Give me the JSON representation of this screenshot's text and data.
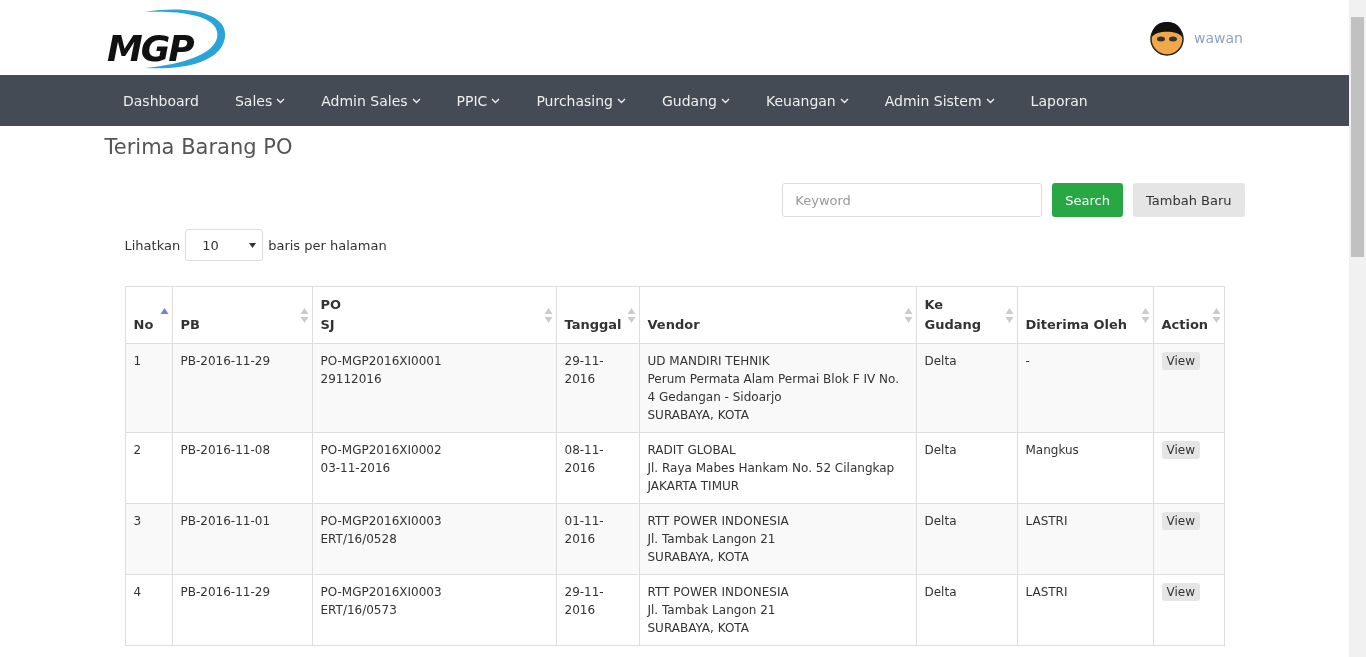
{
  "header": {
    "logo": "MGP",
    "user": {
      "name": "wawan"
    }
  },
  "nav": [
    {
      "label": "Dashboard",
      "dropdown": false
    },
    {
      "label": "Sales",
      "dropdown": true
    },
    {
      "label": "Admin Sales",
      "dropdown": true
    },
    {
      "label": "PPIC",
      "dropdown": true
    },
    {
      "label": "Purchasing",
      "dropdown": true
    },
    {
      "label": "Gudang",
      "dropdown": true
    },
    {
      "label": "Keuangan",
      "dropdown": true
    },
    {
      "label": "Admin Sistem",
      "dropdown": true
    },
    {
      "label": "Laporan",
      "dropdown": false
    }
  ],
  "page_title": "Terima Barang PO",
  "search": {
    "placeholder": "Keyword",
    "button": "Search"
  },
  "add_button": "Tambah Baru",
  "page_size": {
    "before": "Lihatkan",
    "value": "10",
    "after": "baris per halaman"
  },
  "table": {
    "columns": [
      {
        "lines": [
          "No"
        ],
        "sorted": true
      },
      {
        "lines": [
          "PB"
        ],
        "sorted": false
      },
      {
        "lines": [
          "PO",
          "SJ"
        ],
        "sorted": false
      },
      {
        "lines": [
          "Tanggal"
        ],
        "sorted": false
      },
      {
        "lines": [
          "Vendor"
        ],
        "sorted": false
      },
      {
        "lines": [
          "Ke Gudang"
        ],
        "sorted": false
      },
      {
        "lines": [
          "Diterima Oleh"
        ],
        "sorted": false
      },
      {
        "lines": [
          "Action"
        ],
        "sorted": false
      }
    ],
    "rows": [
      {
        "no": "1",
        "pb": "PB-2016-11-29",
        "po": [
          "PO-MGP2016XI0001",
          "29112016"
        ],
        "tanggal": "29-11-2016",
        "vendor": [
          "UD MANDIRI TEHNIK",
          "Perum Permata Alam Permai Blok F IV No. 4 Gedangan - Sidoarjo",
          "SURABAYA, KOTA"
        ],
        "gudang": "Delta",
        "diterima": "-",
        "action": "View"
      },
      {
        "no": "2",
        "pb": "PB-2016-11-08",
        "po": [
          "PO-MGP2016XI0002",
          "03-11-2016"
        ],
        "tanggal": "08-11-2016",
        "vendor": [
          "RADIT GLOBAL",
          "Jl. Raya Mabes Hankam No. 52 Cilangkap",
          "JAKARTA TIMUR"
        ],
        "gudang": "Delta",
        "diterima": "Mangkus",
        "action": "View"
      },
      {
        "no": "3",
        "pb": "PB-2016-11-01",
        "po": [
          "PO-MGP2016XI0003",
          "ERT/16/0528"
        ],
        "tanggal": "01-11-2016",
        "vendor": [
          "RTT POWER INDONESIA",
          "Jl. Tambak Langon 21",
          "SURABAYA, KOTA"
        ],
        "gudang": "Delta",
        "diterima": "LASTRI",
        "action": "View"
      },
      {
        "no": "4",
        "pb": "PB-2016-11-29",
        "po": [
          "PO-MGP2016XI0003",
          "ERT/16/0573"
        ],
        "tanggal": "29-11-2016",
        "vendor": [
          "RTT POWER INDONESIA",
          "Jl. Tambak Langon 21",
          "SURABAYA, KOTA"
        ],
        "gudang": "Delta",
        "diterima": "LASTRI",
        "action": "View"
      }
    ]
  }
}
